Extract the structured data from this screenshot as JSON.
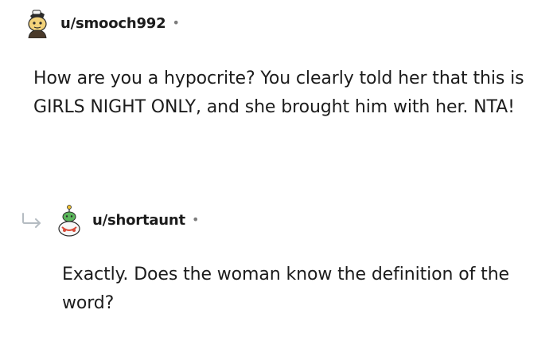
{
  "comments": [
    {
      "username": "u/smooch992",
      "separator": "•",
      "body": "How are you a hypocrite? You clearly told her that this is GIRLS NIGHT ONLY, and she brought him with her. NTA!"
    },
    {
      "username": "u/shortaunt",
      "separator": "•",
      "body": "Exactly. Does the woman know the definition of the word?"
    }
  ],
  "icons": {
    "reply_indicator": "reply-arrow-icon",
    "avatar_1": "snoo-avatar-icon",
    "avatar_2": "snoo-avatar-icon"
  }
}
